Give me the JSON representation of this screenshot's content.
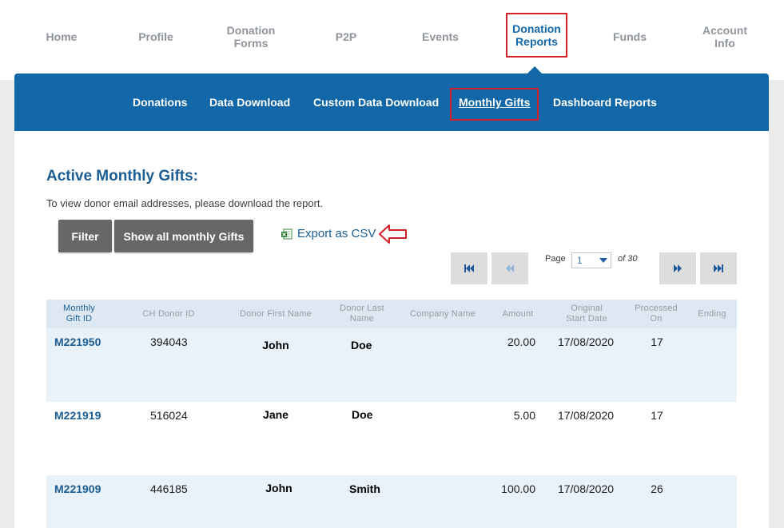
{
  "top_nav": [
    {
      "label": "Home",
      "active": false
    },
    {
      "label": "Profile",
      "active": false
    },
    {
      "label": "Donation\nForms",
      "active": false
    },
    {
      "label": "P2P",
      "active": false
    },
    {
      "label": "Events",
      "active": false
    },
    {
      "label": "Donation\nReports",
      "active": true
    },
    {
      "label": "Funds",
      "active": false
    },
    {
      "label": "Account\nInfo",
      "active": false
    }
  ],
  "sub_nav": [
    {
      "label": "Donations",
      "active": false
    },
    {
      "label": "Data Download",
      "active": false
    },
    {
      "label": "Custom Data Download",
      "active": false
    },
    {
      "label": "Monthly Gifts",
      "active": true
    },
    {
      "label": "Dashboard Reports",
      "active": false
    }
  ],
  "page": {
    "heading": "Active Monthly Gifts:",
    "note": "To view donor email addresses, please download the report."
  },
  "toolbar": {
    "filter_label": "Filter",
    "show_all_label": "Show all monthly Gifts",
    "export_label": "Export as CSV"
  },
  "pagination": {
    "page_label": "Page",
    "current_page": "1",
    "of_label": "of 30"
  },
  "table": {
    "columns": [
      "Monthly\nGift ID",
      "CH Donor ID",
      "Donor First Name",
      "Donor Last\nName",
      "Company Name",
      "Amount",
      "Original\nStart Date",
      "Processed\nOn",
      "Ending"
    ],
    "rows": [
      {
        "gift_id": "M221950",
        "donor_id": "394043",
        "first": "John",
        "last": "Doe",
        "company": "",
        "amount": "20.00",
        "start": "17/08/2020",
        "processed": "17",
        "ending": ""
      },
      {
        "gift_id": "M221919",
        "donor_id": "516024",
        "first": "Jane",
        "last": "Doe",
        "company": "",
        "amount": "5.00",
        "start": "17/08/2020",
        "processed": "17",
        "ending": ""
      },
      {
        "gift_id": "M221909",
        "donor_id": "446185",
        "first": "John",
        "last": "Smith",
        "company": "",
        "amount": "100.00",
        "start": "17/08/2020",
        "processed": "26",
        "ending": ""
      }
    ]
  },
  "colors": {
    "brand_blue": "#1167a8",
    "highlight_red": "#d42029",
    "row_alt": "#e9f1f9",
    "header_bg": "#dde8f3"
  }
}
